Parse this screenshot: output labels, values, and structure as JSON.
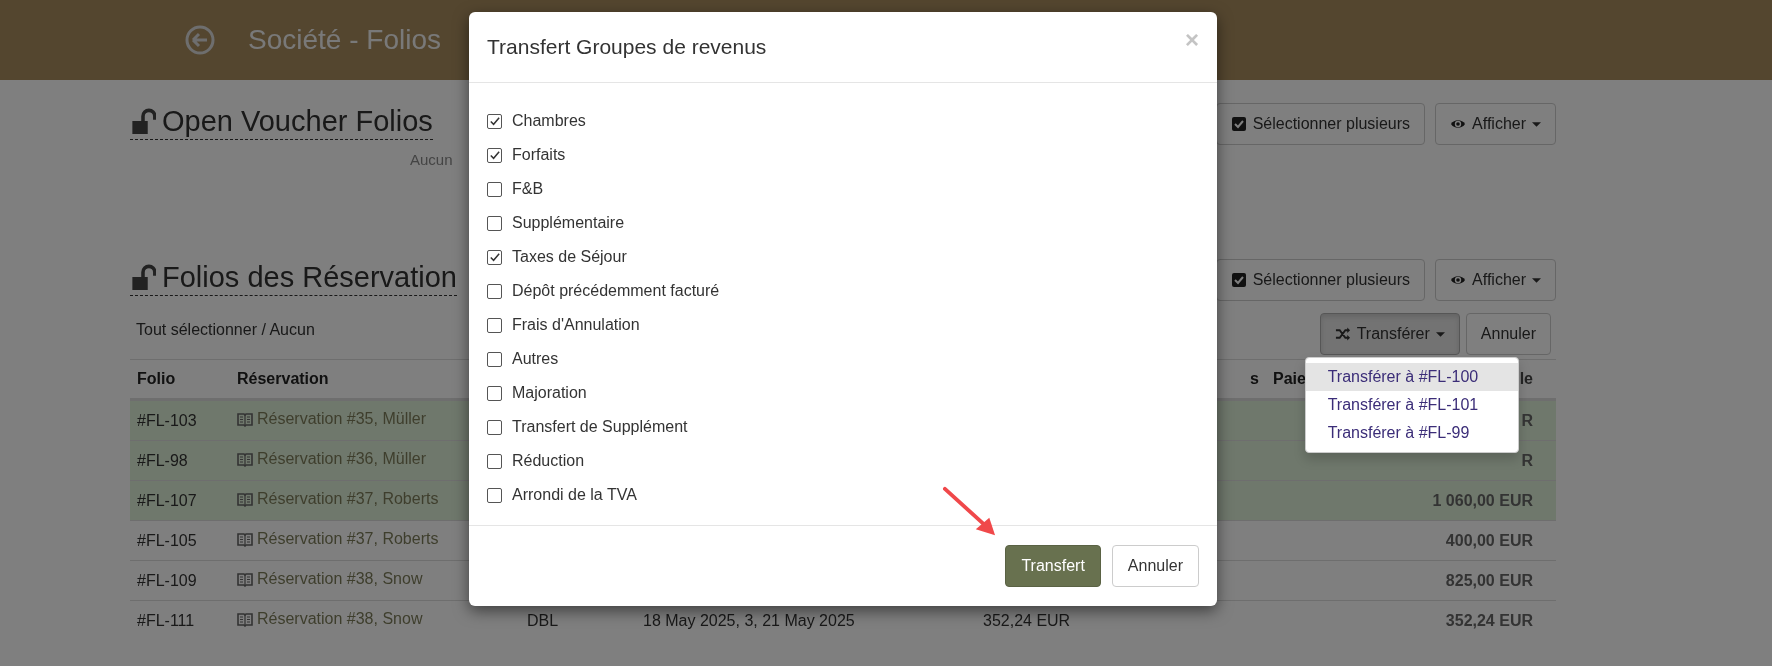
{
  "header": {
    "title": "Société - Folios"
  },
  "sections": [
    {
      "title": "Open Voucher Folios",
      "empty_text": "Aucun",
      "buttons": [
        {
          "label": "Sélectionner plusieurs",
          "kind": "select"
        },
        {
          "label": "Afficher",
          "kind": "view"
        }
      ]
    },
    {
      "title": "Folios des Réservation",
      "select_links": "Tout sélectionner / Aucun",
      "buttons": [
        {
          "label": "Sélectionner plusieurs",
          "kind": "select"
        },
        {
          "label": "Afficher",
          "kind": "view"
        }
      ],
      "actions": [
        {
          "label": "Transférer",
          "kind": "transfer",
          "active": true
        },
        {
          "label": "Annuler",
          "kind": "cancel",
          "active": false
        }
      ],
      "dropdown": [
        {
          "label": "Transférer à #FL-100",
          "selected": true
        },
        {
          "label": "Transférer à #FL-101",
          "selected": false
        },
        {
          "label": "Transférer à #FL-99",
          "selected": false
        }
      ]
    }
  ],
  "table": {
    "header": {
      "folio": "Folio",
      "reservation": "Réservation",
      "column_6": "s",
      "column_7": "Paie",
      "column_8": "le"
    },
    "rows": [
      {
        "folio": "#FL-103",
        "reservation": "Réservation #35, Müller",
        "column_8": "R",
        "selected": true
      },
      {
        "folio": "#FL-98",
        "reservation": "Réservation #36, Müller",
        "column_8": "R",
        "selected": true
      },
      {
        "folio": "#FL-107",
        "reservation": "Réservation #37, Roberts",
        "column_8": "1 060,00 EUR",
        "selected": true
      },
      {
        "folio": "#FL-105",
        "reservation": "Réservation #37, Roberts",
        "column_8": "400,00 EUR",
        "selected": false
      },
      {
        "folio": "#FL-109",
        "reservation": "Réservation #38, Snow",
        "column_8": "825,00 EUR",
        "selected": false
      },
      {
        "folio": "#FL-111",
        "reservation": "Réservation #38, Snow",
        "room": "DBL",
        "dates": "18 May 2025, 3, 21 May 2025",
        "amount": "352,24 EUR",
        "column_8": "352,24 EUR",
        "selected": false
      }
    ]
  },
  "modal": {
    "title": "Transfert Groupes de revenus",
    "close": "×",
    "items": [
      {
        "label": "Chambres",
        "checked": true
      },
      {
        "label": "Forfaits",
        "checked": true
      },
      {
        "label": "F&B",
        "checked": false
      },
      {
        "label": "Supplémentaire",
        "checked": false
      },
      {
        "label": "Taxes de Séjour",
        "checked": true
      },
      {
        "label": "Dépôt précédemment facturé",
        "checked": false
      },
      {
        "label": "Frais d'Annulation",
        "checked": false
      },
      {
        "label": "Autres",
        "checked": false
      },
      {
        "label": "Majoration",
        "checked": false
      },
      {
        "label": "Transfert de Supplément",
        "checked": false
      },
      {
        "label": "Réduction",
        "checked": false
      },
      {
        "label": "Arrondi de la TVA",
        "checked": false
      }
    ],
    "buttons": [
      {
        "label": "Transfert",
        "kind": "primary"
      },
      {
        "label": "Annuler",
        "kind": "default"
      }
    ]
  }
}
